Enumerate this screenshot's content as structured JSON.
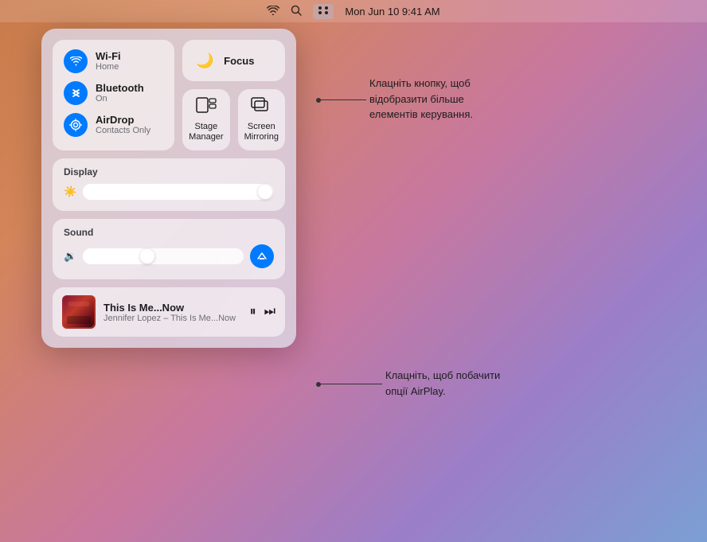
{
  "menubar": {
    "time": "Mon Jun 10  9:41 AM",
    "wifi_icon": "wifi",
    "search_icon": "search",
    "control_icon": "control-center"
  },
  "control_center": {
    "wifi": {
      "label": "Wi-Fi",
      "sublabel": "Home"
    },
    "bluetooth": {
      "label": "Bluetooth",
      "sublabel": "On"
    },
    "airdrop": {
      "label": "AirDrop",
      "sublabel": "Contacts Only"
    },
    "focus": {
      "label": "Focus"
    },
    "stage_manager": {
      "label": "Stage\nManager"
    },
    "screen_mirroring": {
      "label": "Screen\nMirroring"
    },
    "display": {
      "title": "Display"
    },
    "sound": {
      "title": "Sound"
    },
    "now_playing": {
      "track": "This Is Me...Now",
      "artist": "Jennifer Lopez – This Is Me...Now"
    }
  },
  "annotations": {
    "focus_annotation": "Клацніть кнопку, щоб відобразити більше елементів керування.",
    "airplay_annotation": "Клацніть, щоб побачити опції AirPlay."
  }
}
